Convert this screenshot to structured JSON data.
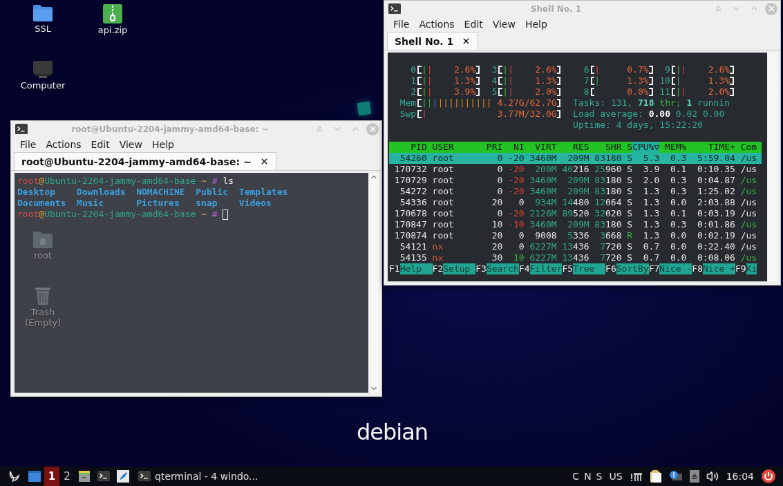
{
  "desktop": {
    "icons": [
      {
        "label": "SSL",
        "kind": "folder"
      },
      {
        "label": "api.zip",
        "kind": "archive"
      },
      {
        "label": "Computer",
        "kind": "computer"
      },
      {
        "label": "root",
        "kind": "home"
      },
      {
        "label": "Trash (Empty)",
        "kind": "trash"
      }
    ],
    "wallpaper_text": "debian"
  },
  "terminal_window": {
    "title": "root@Ubuntu-2204-jammy-amd64-base: ~",
    "menu": [
      "File",
      "Actions",
      "Edit",
      "View",
      "Help"
    ],
    "tabs": [
      {
        "label": "root@Ubuntu-2204-jammy-amd64-base: ~",
        "selected": true
      }
    ],
    "lines": [
      {
        "kind": "prompt",
        "segments": [
          {
            "text": "root",
            "kind": "user"
          },
          {
            "text": "@",
            "kind": "at"
          },
          {
            "text": "Ubuntu-2204-jammy-amd64-base",
            "kind": "host"
          },
          {
            "text": " ~ ",
            "kind": "path"
          },
          {
            "text": "#",
            "kind": "symbol"
          },
          {
            "text": " ls",
            "kind": "command"
          }
        ]
      },
      {
        "kind": "listing",
        "entries": [
          "Desktop",
          "Documents",
          "Downloads",
          "Music",
          "NOMACHINE",
          "Pictures",
          "Public",
          "snap",
          "Templates",
          "Videos"
        ]
      },
      {
        "kind": "prompt",
        "cursor": true,
        "segments": [
          {
            "text": "root",
            "kind": "user"
          },
          {
            "text": "@",
            "kind": "at"
          },
          {
            "text": "Ubuntu-2204-jammy-amd64-base",
            "kind": "host"
          },
          {
            "text": " ~ ",
            "kind": "path"
          },
          {
            "text": "#",
            "kind": "symbol"
          }
        ]
      }
    ]
  },
  "htop_window": {
    "title": "Shell No. 1",
    "menu": [
      "File",
      "Actions",
      "Edit",
      "View",
      "Help"
    ],
    "tabs": [
      {
        "label": "Shell No. 1",
        "selected": true
      }
    ],
    "htop": {
      "cpu_meters": [
        {
          "label": "0",
          "bar": [
            {
              "text": "|",
              "kind": "user"
            },
            {
              "text": "|",
              "kind": "kernel"
            }
          ],
          "reading": "2.6%"
        },
        {
          "label": "1",
          "bar": [
            {
              "text": "|",
              "kind": "user"
            },
            {
              "text": "|",
              "kind": "kernel"
            }
          ],
          "reading": "1.3%"
        },
        {
          "label": "2",
          "bar": [
            {
              "text": "|",
              "kind": "user"
            },
            {
              "text": "|",
              "kind": "kernel"
            }
          ],
          "reading": "3.9%"
        },
        {
          "label": "3",
          "bar": [
            {
              "text": "|",
              "kind": "user"
            },
            {
              "text": "|",
              "kind": "kernel"
            }
          ],
          "reading": "2.6%"
        },
        {
          "label": "4",
          "bar": [
            {
              "text": "|",
              "kind": "user"
            },
            {
              "text": "|",
              "kind": "kernel"
            }
          ],
          "reading": "1.3%"
        },
        {
          "label": "5",
          "bar": [
            {
              "text": "|",
              "kind": "user"
            },
            {
              "text": "|",
              "kind": "kernel"
            }
          ],
          "reading": "2.0%"
        },
        {
          "label": "6",
          "bar": [
            {
              "text": "|",
              "kind": "kernel"
            }
          ],
          "reading": "0.7%"
        },
        {
          "label": "7",
          "bar": [
            {
              "text": "|",
              "kind": "user"
            }
          ],
          "reading": "1.3%"
        },
        {
          "label": "8",
          "reading": "0.0%"
        },
        {
          "label": "9",
          "bar": [
            {
              "text": "|",
              "kind": "user"
            },
            {
              "text": "|",
              "kind": "kernel"
            }
          ],
          "reading": "2.6%"
        },
        {
          "label": "10",
          "bar": [
            {
              "text": "|",
              "kind": "user"
            }
          ],
          "reading": "1.3%"
        },
        {
          "label": "11",
          "bar": [
            {
              "text": "|",
              "kind": "user"
            },
            {
              "text": "|",
              "kind": "kernel"
            }
          ],
          "reading": "2.0%"
        }
      ],
      "memory_meters": [
        {
          "label": "Mem",
          "bar": [
            {
              "text": "||",
              "kind": "user"
            },
            {
              "text": "|",
              "kind": "buffers"
            },
            {
              "text": "||||||||||",
              "kind": "cache"
            }
          ],
          "reading": "4.27G/62.7G"
        },
        {
          "label": "Swp",
          "bar": [
            {
              "text": "|",
              "kind": "kernel"
            }
          ],
          "reading": "3.77M/32.0G"
        }
      ],
      "summary": [
        {
          "segments": [
            {
              "text": "Tasks: ",
              "kind": "label"
            },
            {
              "text": "131",
              "kind": "label"
            },
            {
              "text": ", ",
              "kind": "label"
            },
            {
              "text": "718",
              "kind": "bold"
            },
            {
              "text": " thr",
              "kind": "thread"
            },
            {
              "text": "; ",
              "kind": "label"
            },
            {
              "text": "1",
              "kind": "bold"
            },
            {
              "text": " runnin",
              "kind": "label"
            }
          ]
        },
        {
          "segments": [
            {
              "text": "Load average: ",
              "kind": "label"
            },
            {
              "text": "0.00",
              "kind": "highlight"
            },
            {
              "text": " 0.02 0.00",
              "kind": "label"
            }
          ]
        },
        {
          "segments": [
            {
              "text": "Uptime: ",
              "kind": "label"
            },
            {
              "text": "4 days, 15:22:20",
              "kind": "label"
            }
          ]
        }
      ],
      "columns": [
        {
          "label": "PID",
          "sorted": false
        },
        {
          "label": "USER",
          "sorted": false
        },
        {
          "label": "PRI",
          "sorted": false
        },
        {
          "label": "NI",
          "sorted": false
        },
        {
          "label": "VIRT",
          "sorted": false
        },
        {
          "label": "RES",
          "sorted": false
        },
        {
          "label": "SHR",
          "sorted": false
        },
        {
          "label": "S",
          "sorted": false
        },
        {
          "label": "CPU%▽",
          "sorted": true
        },
        {
          "label": "MEM%",
          "sorted": false
        },
        {
          "label": "TIME+",
          "sorted": false
        },
        {
          "label": "Com",
          "sorted": false
        }
      ],
      "processes": [
        {
          "selected": true,
          "cells": [
            "54260",
            "root",
            "0",
            "-20",
            "3460M",
            "209M",
            "83180",
            "S",
            "5.3",
            "0.3",
            "5:59.04",
            "/us"
          ]
        },
        {
          "selected": false,
          "cells": [
            "170732",
            "root",
            "0",
            [
              {
                "text": "-20",
                "kind": "nice"
              }
            ],
            [
              {
                "text": "200M",
                "kind": "large"
              }
            ],
            [
              {
                "text": "40",
                "kind": "large"
              },
              {
                "text": "216",
                "kind": "plain"
              }
            ],
            [
              {
                "text": "25",
                "kind": "large"
              },
              {
                "text": "960",
                "kind": "plain"
              }
            ],
            "S",
            "3.9",
            "0.1",
            "0:10.35",
            "/us"
          ]
        },
        {
          "selected": false,
          "cells": [
            "170729",
            "root",
            "0",
            [
              {
                "text": "-20",
                "kind": "nice"
              }
            ],
            [
              {
                "text": "3460M",
                "kind": "large"
              }
            ],
            [
              {
                "text": "209M",
                "kind": "large"
              }
            ],
            [
              {
                "text": "83",
                "kind": "large"
              },
              {
                "text": "180",
                "kind": "plain"
              }
            ],
            "S",
            "2.0",
            "0.3",
            "0:04.87",
            [
              {
                "text": "/us",
                "kind": "thread"
              }
            ]
          ]
        },
        {
          "selected": false,
          "cells": [
            "54272",
            "root",
            "0",
            [
              {
                "text": "-20",
                "kind": "nice"
              }
            ],
            [
              {
                "text": "3460M",
                "kind": "large"
              }
            ],
            [
              {
                "text": "209M",
                "kind": "large"
              }
            ],
            [
              {
                "text": "83",
                "kind": "large"
              },
              {
                "text": "180",
                "kind": "plain"
              }
            ],
            "S",
            "1.3",
            "0.3",
            "1:25.02",
            [
              {
                "text": "/us",
                "kind": "thread"
              }
            ]
          ]
        },
        {
          "selected": false,
          "cells": [
            "54336",
            "root",
            "20",
            "0",
            [
              {
                "text": "934M",
                "kind": "large"
              }
            ],
            [
              {
                "text": "14",
                "kind": "large"
              },
              {
                "text": "480",
                "kind": "plain"
              }
            ],
            [
              {
                "text": "12",
                "kind": "large"
              },
              {
                "text": "064",
                "kind": "plain"
              }
            ],
            "S",
            "1.3",
            "0.0",
            "2:03.88",
            "/us"
          ]
        },
        {
          "selected": false,
          "cells": [
            "170678",
            "root",
            "0",
            [
              {
                "text": "-20",
                "kind": "nice"
              }
            ],
            [
              {
                "text": "2126M",
                "kind": "large"
              }
            ],
            [
              {
                "text": "89",
                "kind": "large"
              },
              {
                "text": "520",
                "kind": "plain"
              }
            ],
            [
              {
                "text": "32",
                "kind": "large"
              },
              {
                "text": "020",
                "kind": "plain"
              }
            ],
            "S",
            "1.3",
            "0.1",
            "0:03.19",
            "/us"
          ]
        },
        {
          "selected": false,
          "cells": [
            "170847",
            "root",
            "10",
            [
              {
                "text": "-10",
                "kind": "nice"
              }
            ],
            [
              {
                "text": "3460M",
                "kind": "large"
              }
            ],
            [
              {
                "text": "209M",
                "kind": "large"
              }
            ],
            [
              {
                "text": "83",
                "kind": "large"
              },
              {
                "text": "180",
                "kind": "plain"
              }
            ],
            "S",
            "1.3",
            "0.3",
            "0:01.86",
            [
              {
                "text": "/us",
                "kind": "thread"
              }
            ]
          ]
        },
        {
          "selected": false,
          "cells": [
            "170874",
            "root",
            "20",
            "0",
            "9008",
            [
              {
                "text": "5",
                "kind": "large"
              },
              {
                "text": "336",
                "kind": "plain"
              }
            ],
            [
              {
                "text": "3",
                "kind": "large"
              },
              {
                "text": "668",
                "kind": "plain"
              }
            ],
            [
              {
                "text": "R",
                "kind": "running"
              }
            ],
            "1.3",
            "0.0",
            "0:02.19",
            "/us"
          ]
        },
        {
          "selected": false,
          "cells": [
            "54121",
            [
              {
                "text": "nx",
                "kind": "other_user"
              }
            ],
            "20",
            "0",
            [
              {
                "text": "6227M",
                "kind": "large"
              }
            ],
            [
              {
                "text": "13",
                "kind": "large"
              },
              {
                "text": "436",
                "kind": "plain"
              }
            ],
            [
              {
                "text": "7",
                "kind": "large"
              },
              {
                "text": "720",
                "kind": "plain"
              }
            ],
            "S",
            "0.7",
            "0.0",
            "0:22.40",
            "/us"
          ]
        },
        {
          "selected": false,
          "cells": [
            "54135",
            [
              {
                "text": "nx",
                "kind": "other_user"
              }
            ],
            "30",
            [
              {
                "text": "10",
                "kind": "positive"
              }
            ],
            [
              {
                "text": "6227M",
                "kind": "large"
              }
            ],
            [
              {
                "text": "13",
                "kind": "large"
              },
              {
                "text": "436",
                "kind": "plain"
              }
            ],
            [
              {
                "text": "7",
                "kind": "large"
              },
              {
                "text": "720",
                "kind": "plain"
              }
            ],
            "S",
            "0.7",
            "0.0",
            "0:08.06",
            [
              {
                "text": "/us",
                "kind": "thread"
              }
            ]
          ]
        }
      ],
      "function_keys": [
        {
          "key": "F1",
          "label": "Help"
        },
        {
          "key": "F2",
          "label": "Setup"
        },
        {
          "key": "F3",
          "label": "Search"
        },
        {
          "key": "F4",
          "label": "Filter"
        },
        {
          "key": "F5",
          "label": "Tree"
        },
        {
          "key": "F6",
          "label": "SortBy"
        },
        {
          "key": "F7",
          "label": "Nice -"
        },
        {
          "key": "F8",
          "label": "Nice +"
        },
        {
          "key": "F9",
          "label": "Ki"
        }
      ]
    }
  },
  "taskbar": {
    "workspaces": [
      {
        "label": "1",
        "selected": true
      },
      {
        "label": "2",
        "selected": false
      }
    ],
    "tasks": [
      {
        "label": "qterminal - 4 windo..."
      }
    ],
    "indicators": [
      "C",
      "N",
      "S"
    ],
    "layout": "US",
    "clock": "16:04"
  }
}
